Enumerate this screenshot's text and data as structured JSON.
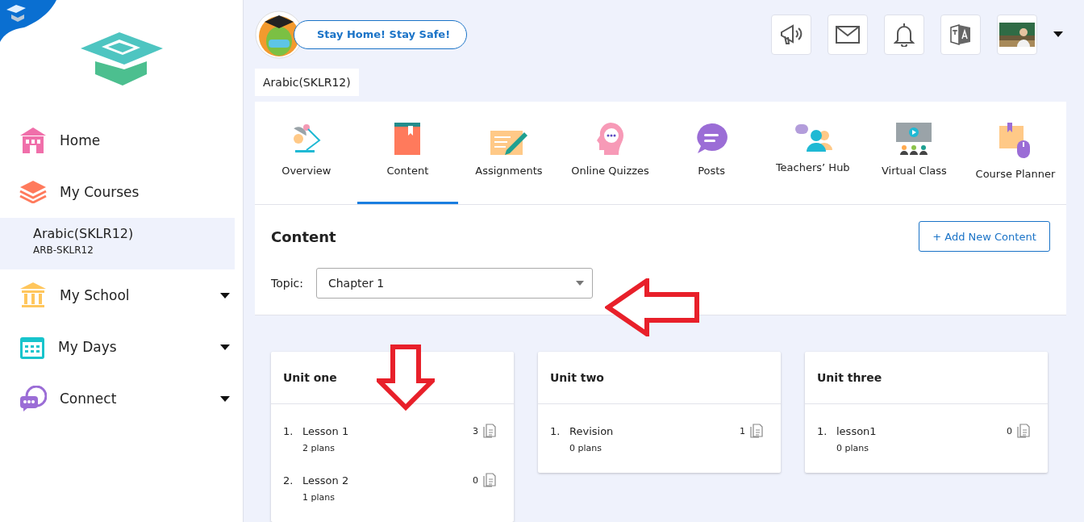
{
  "sidebar": {
    "items": [
      {
        "label": "Home",
        "has_dropdown": false
      },
      {
        "label": "My Courses",
        "has_dropdown": false,
        "children": [
          {
            "title": "Arabic(SKLR12)",
            "code": "ARB-SKLR12",
            "selected": true
          }
        ]
      },
      {
        "label": "My School",
        "has_dropdown": true
      },
      {
        "label": "My Days",
        "has_dropdown": true
      },
      {
        "label": "Connect",
        "has_dropdown": true
      }
    ]
  },
  "header": {
    "banner": "Stay Home! Stay Safe!",
    "course_tag": "Arabic(SKLR12)"
  },
  "tabs": [
    {
      "label": "Overview",
      "selected": false
    },
    {
      "label": "Content",
      "selected": true
    },
    {
      "label": "Assignments",
      "selected": false
    },
    {
      "label": "Online Quizzes",
      "selected": false
    },
    {
      "label": "Posts",
      "selected": false
    },
    {
      "label": "Teachers’ Hub",
      "selected": false
    },
    {
      "label": "Virtual Class",
      "selected": false
    },
    {
      "label": "Course Planner",
      "selected": false
    }
  ],
  "content": {
    "title": "Content",
    "add_button": "+ Add New Content",
    "topic_label": "Topic:",
    "topic_value": "Chapter 1"
  },
  "units": [
    {
      "title": "Unit one",
      "lessons": [
        {
          "number": "1.",
          "title": "Lesson 1",
          "count": "3",
          "plans": "2 plans"
        },
        {
          "number": "2.",
          "title": "Lesson 2",
          "count": "0",
          "plans": "1 plans"
        }
      ]
    },
    {
      "title": "Unit two",
      "lessons": [
        {
          "number": "1.",
          "title": "Revision",
          "count": "1",
          "plans": "0 plans"
        }
      ]
    },
    {
      "title": "Unit three",
      "lessons": [
        {
          "number": "1.",
          "title": "lesson1",
          "count": "0",
          "plans": "0 plans"
        }
      ]
    }
  ]
}
